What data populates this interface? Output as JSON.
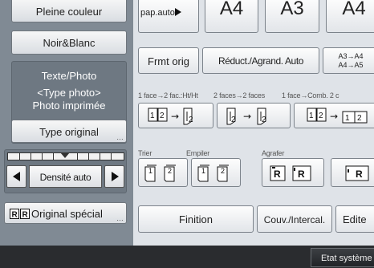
{
  "left_panel": {
    "color_full": "Pleine couleur",
    "bw": "Noir&Blanc",
    "mode_title": "Texte/Photo",
    "mode_sub1": "<Type photo>",
    "mode_sub2": "Photo imprimée",
    "type_button": "Type original",
    "density_label": "Densité auto",
    "special_original": "Original spécial"
  },
  "right_panel": {
    "paper_auto": "pap.auto",
    "big_buttons": [
      "A4",
      "A3",
      "A4"
    ],
    "original_format": "Frmt orig",
    "reduce_enlarge": "Réduct./Agrand. Auto",
    "a3a4_line1": "A3→A4",
    "a3a4_line2": "A4→A5",
    "duplex_captions": [
      "1 face→2 fac.:Ht/Ht",
      "2 faces→2 faces",
      "1 face→Comb. 2 c"
    ],
    "finish_captions": [
      "Trier",
      "Empiler",
      "Agrafer"
    ],
    "tabs": [
      "Finition",
      "Couv./Intercal.",
      "Edite"
    ]
  },
  "status_bar": {
    "status_button": "Etat système"
  }
}
